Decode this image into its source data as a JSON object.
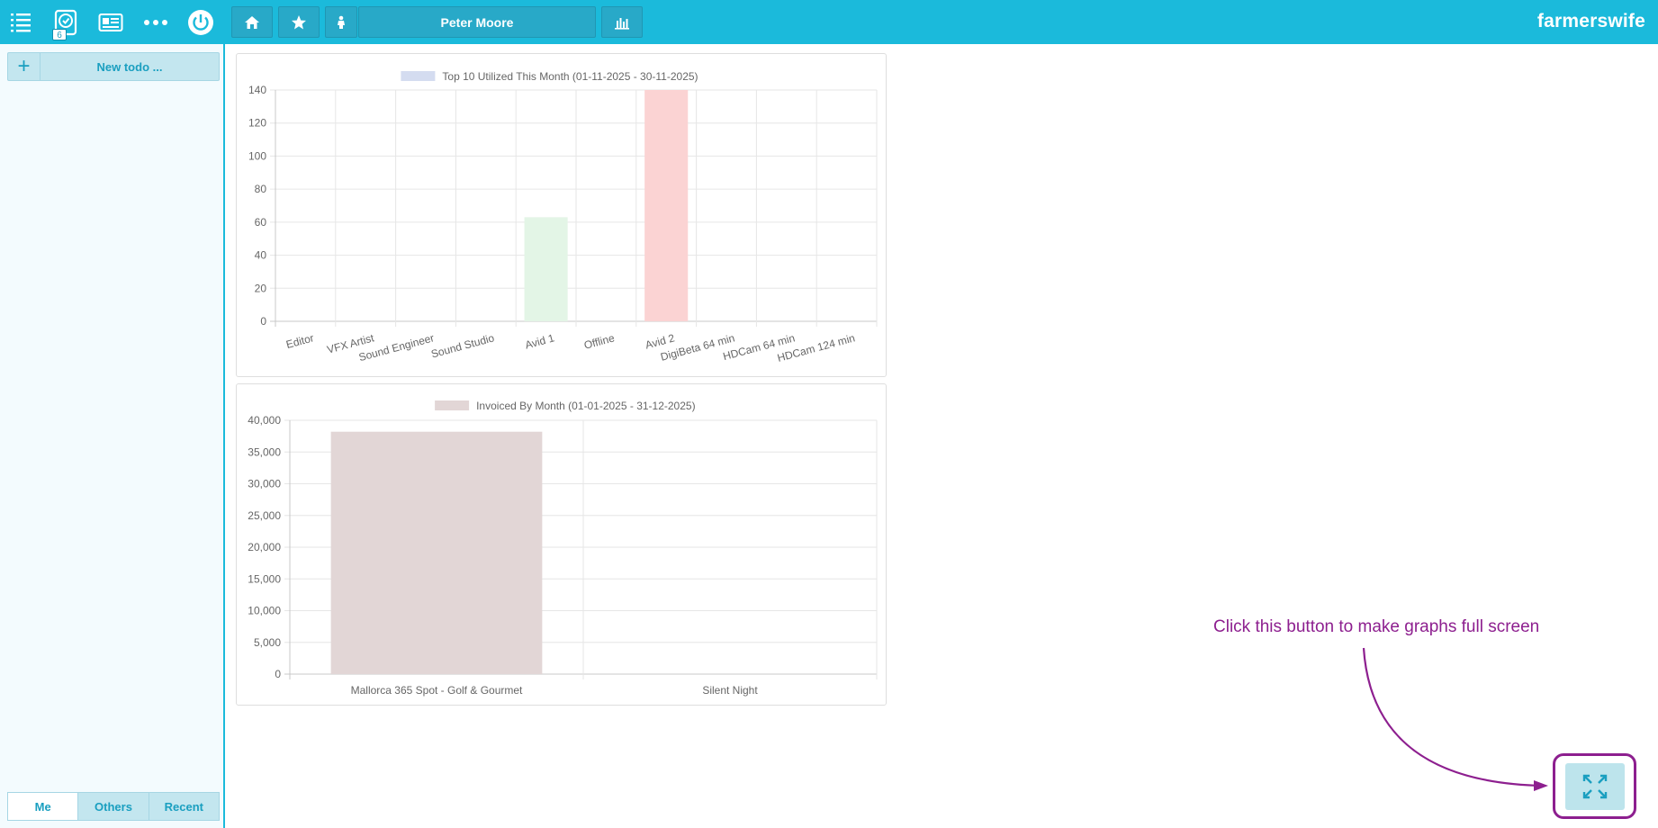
{
  "app": {
    "brand": "farmerswife",
    "user_name": "Peter Moore",
    "notification_count": "6",
    "colors": {
      "accent": "#1bbadb",
      "annotation": "#8d1f8f"
    }
  },
  "toolbar": {
    "icons": [
      "list-icon",
      "clock-icon",
      "card-icon",
      "more-icon",
      "power-icon"
    ],
    "nav": [
      "home-icon",
      "star-icon",
      "person-icon",
      "bar-chart-icon"
    ]
  },
  "sidebar": {
    "new_todo_label": "New todo ...",
    "add_symbol": "+",
    "tabs": [
      {
        "label": "Me",
        "active": true
      },
      {
        "label": "Others",
        "active": false
      },
      {
        "label": "Recent",
        "active": false
      }
    ]
  },
  "chart_data": [
    {
      "type": "bar",
      "title": "Top 10 Utilized This Month (01-11-2025 - 30-11-2025)",
      "categories": [
        "Editor",
        "VFX Artist",
        "Sound Engineer",
        "Sound Studio",
        "Avid 1",
        "Offline",
        "Avid 2",
        "DigiBeta 64 min",
        "HDCam 64 min",
        "HDCam 124 min"
      ],
      "values": [
        0,
        0,
        0,
        0,
        63,
        0,
        140,
        0,
        0,
        0
      ],
      "bar_colors": [
        "#d4dcf0",
        "#d4dcf0",
        "#d4dcf0",
        "#d4dcf0",
        "#e3f5e6",
        "#d4dcf0",
        "#fbd3d3",
        "#d4dcf0",
        "#d4dcf0",
        "#d4dcf0"
      ],
      "legend_color": "#d4dcf0",
      "ylim": [
        0,
        140
      ],
      "yticks": [
        "0",
        "20",
        "40",
        "60",
        "80",
        "100",
        "120",
        "140"
      ],
      "legend": "top"
    },
    {
      "type": "bar",
      "title": "Invoiced By Month (01-01-2025 - 31-12-2025)",
      "categories": [
        "Mallorca 365 Spot - Golf & Gourmet",
        "Silent Night"
      ],
      "values": [
        38200,
        0
      ],
      "bar_colors": [
        "#e2d6d6",
        "#e2d6d6"
      ],
      "legend_color": "#e2d6d6",
      "ylim": [
        0,
        40000
      ],
      "yticks": [
        "0",
        "5,000",
        "10,000",
        "15,000",
        "20,000",
        "25,000",
        "30,000",
        "35,000",
        "40,000"
      ],
      "legend": "top"
    }
  ],
  "annotation": {
    "text": "Click this button to make graphs full screen"
  }
}
